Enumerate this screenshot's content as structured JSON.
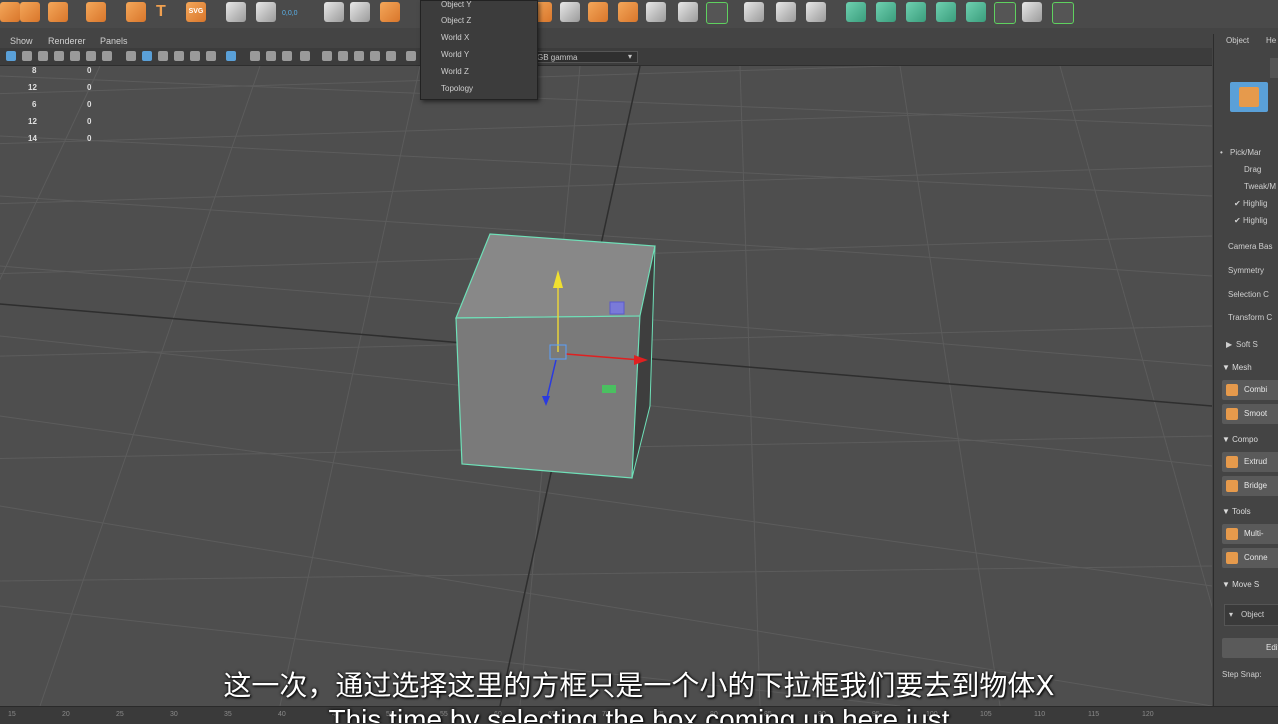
{
  "panel_menu": {
    "show": "Show",
    "renderer": "Renderer",
    "panels": "Panels"
  },
  "color_space": "GB gamma",
  "stats": [
    {
      "value": "8",
      "count": "0"
    },
    {
      "value": "12",
      "count": "0"
    },
    {
      "value": "6",
      "count": "0"
    },
    {
      "value": "12",
      "count": "0"
    },
    {
      "value": "14",
      "count": "0"
    }
  ],
  "shelf": {
    "svg_label": "SVG",
    "coord_label": "0,0,0"
  },
  "dropdown": {
    "items": [
      "Object Y",
      "Object Z",
      "World X",
      "World Y",
      "World Z",
      "Topology"
    ]
  },
  "sidebar": {
    "tabs": {
      "object": "Object",
      "help": "He"
    },
    "pick": "Pick/Mar",
    "drag": "Drag",
    "tweak": "Tweak/M",
    "highlight1": "Highlig",
    "highlight2": "Highlig",
    "camera": "Camera Bas",
    "symmetry": "Symmetry",
    "selection": "Selection C",
    "transform": "Transform C",
    "soft": "Soft S",
    "mesh_hdr": "Mesh",
    "combine": "Combi",
    "smooth": "Smoot",
    "components_hdr": "Compo",
    "extrude": "Extrud",
    "bridge": "Bridge",
    "tools_hdr": "Tools",
    "multicut": "Multi-",
    "connect": "Conne",
    "move_hdr": "Move S",
    "object_field": "Object",
    "edit_btn": "Edit",
    "step_snap": "Step Snap:"
  },
  "subtitle_cn": "这一次，通过选择这里的方框只是一个小的下拉框我们要去到物体X",
  "subtitle_en": "This time by selecting the box coming up here just",
  "timeline_ticks": [
    "15",
    "20",
    "25",
    "30",
    "35",
    "40",
    "45",
    "50",
    "55",
    "60",
    "65",
    "70",
    "75",
    "80",
    "85",
    "90",
    "95",
    "100",
    "105",
    "110",
    "115",
    "120"
  ]
}
